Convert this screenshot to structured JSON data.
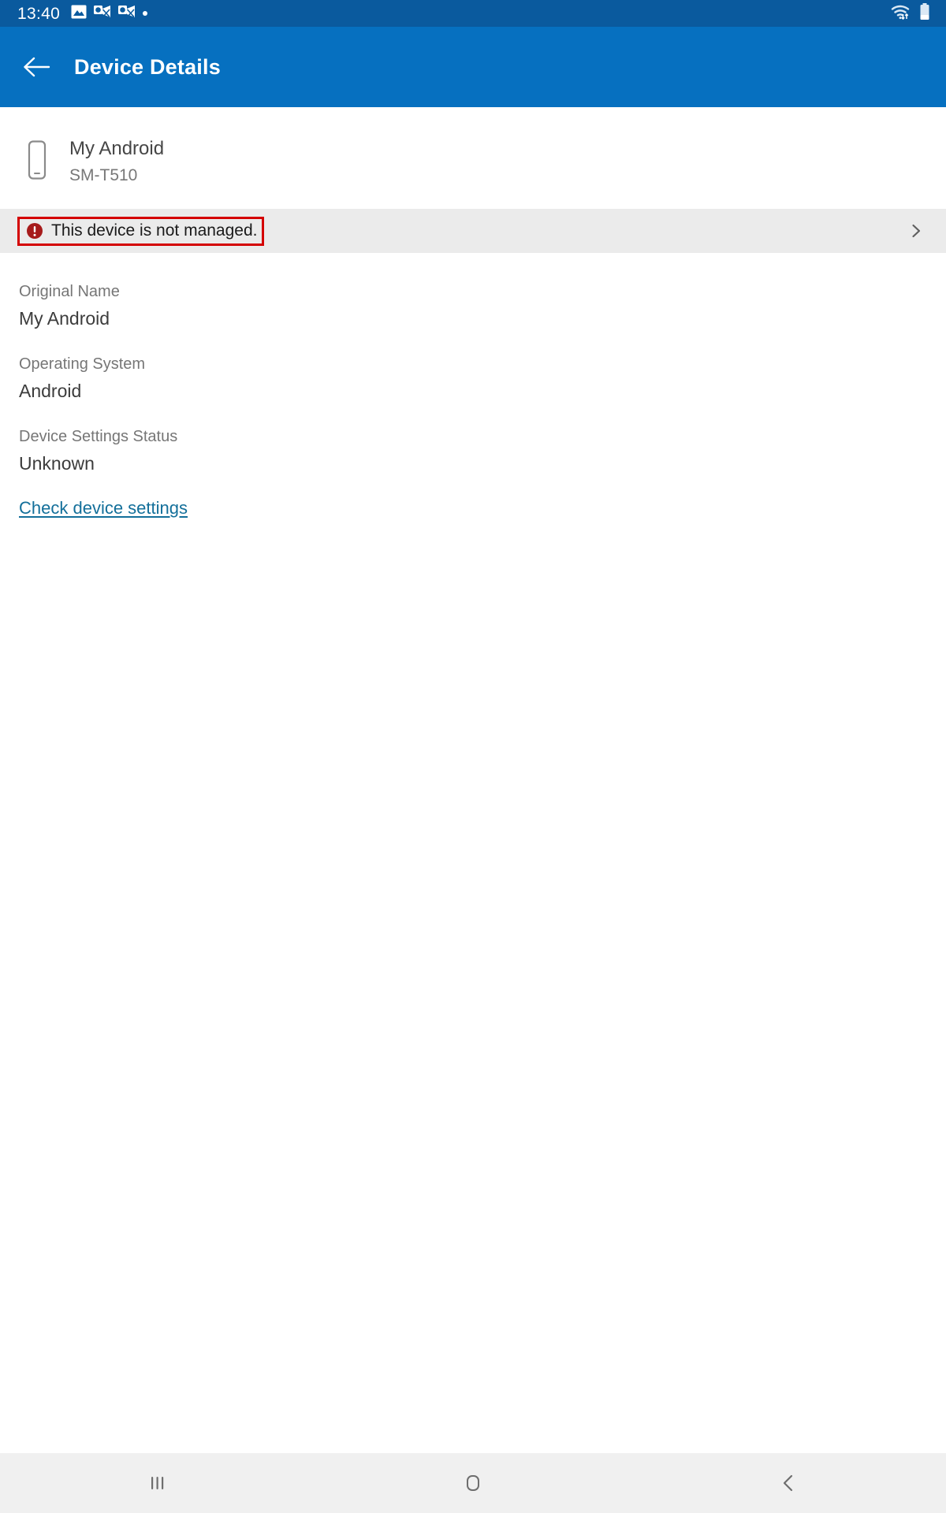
{
  "status_bar": {
    "clock": "13:40",
    "left_icons": [
      "image-icon",
      "outlook-mail-icon",
      "outlook-mail-icon",
      "dot-icon"
    ],
    "right_icons": [
      "wifi-icon",
      "battery-icon"
    ],
    "background_color": "#0a5a9e"
  },
  "app_bar": {
    "back_label": "Back",
    "title": "Device Details",
    "background_color": "#0670c0"
  },
  "device_header": {
    "icon": "smartphone-icon",
    "name": "My Android",
    "model": "SM-T510"
  },
  "status_banner": {
    "icon": "error-circle-icon",
    "message": "This device is not managed.",
    "chevron": "chevron-right-icon",
    "highlight_color": "#d40000",
    "background_color": "#ebebeb"
  },
  "details": {
    "fields": [
      {
        "label": "Original Name",
        "value": "My Android"
      },
      {
        "label": "Operating System",
        "value": "Android"
      },
      {
        "label": "Device Settings Status",
        "value": "Unknown"
      }
    ],
    "link": {
      "label": "Check device settings",
      "color": "#136f9a"
    }
  },
  "nav_bar": {
    "recents_label": "Recent apps",
    "home_label": "Home",
    "back_label": "Back",
    "background_color": "#f0f0f0"
  }
}
